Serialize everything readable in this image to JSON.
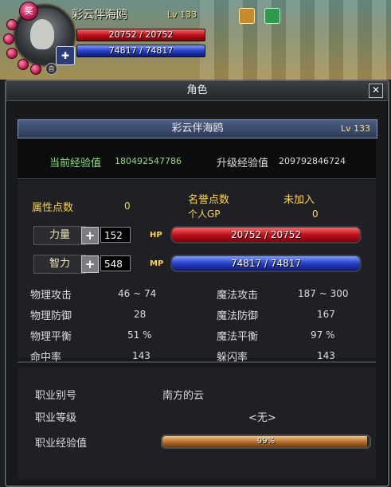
{
  "hud": {
    "name": "彩云伴海鸥",
    "level_label": "Lv 133",
    "hp_text": "20752 / 20752",
    "mp_text": "74817 / 74817",
    "buff_text": "奖",
    "small_badge": "自"
  },
  "window": {
    "title": "角色",
    "close_glyph": "✕"
  },
  "profile": {
    "name": "彩云伴海鸥",
    "level": "Lv 133",
    "cur_exp_label": "当前经验值",
    "cur_exp_value": "180492547786",
    "next_exp_label": "升级经验值",
    "next_exp_value": "209792846724"
  },
  "attributes": {
    "points_label": "属性点数",
    "points_value": "0",
    "honor_label": "名誉点数",
    "honor_value": "未加入",
    "gp_label": "个人GP",
    "gp_value": "0",
    "str_label": "力量",
    "str_value": "152",
    "int_label": "智力",
    "int_value": "548",
    "hp_label": "HP",
    "hp_value": "20752 / 20752",
    "mp_label": "MP",
    "mp_value": "74817 / 74817"
  },
  "stats": {
    "left": [
      {
        "label": "物理攻击",
        "value": "46 ~ 74"
      },
      {
        "label": "物理防御",
        "value": "28"
      },
      {
        "label": "物理平衡",
        "value": "51 %"
      },
      {
        "label": "命中率",
        "value": "143"
      }
    ],
    "right": [
      {
        "label": "魔法攻击",
        "value": "187 ~ 300"
      },
      {
        "label": "魔法防御",
        "value": "167"
      },
      {
        "label": "魔法平衡",
        "value": "97 %"
      },
      {
        "label": "躲闪率",
        "value": "143"
      }
    ]
  },
  "job": {
    "alias_label": "职业别号",
    "alias_value": "南方的云",
    "level_label": "职业等级",
    "level_value": "<无>",
    "exp_label": "职业经验值",
    "exp_text": "99%",
    "exp_fraction": 0.99
  },
  "colors": {
    "hp": "#c0101c",
    "mp": "#2840c8",
    "label_yellow": "#ffd34a",
    "job_bar": "#b9722c"
  }
}
